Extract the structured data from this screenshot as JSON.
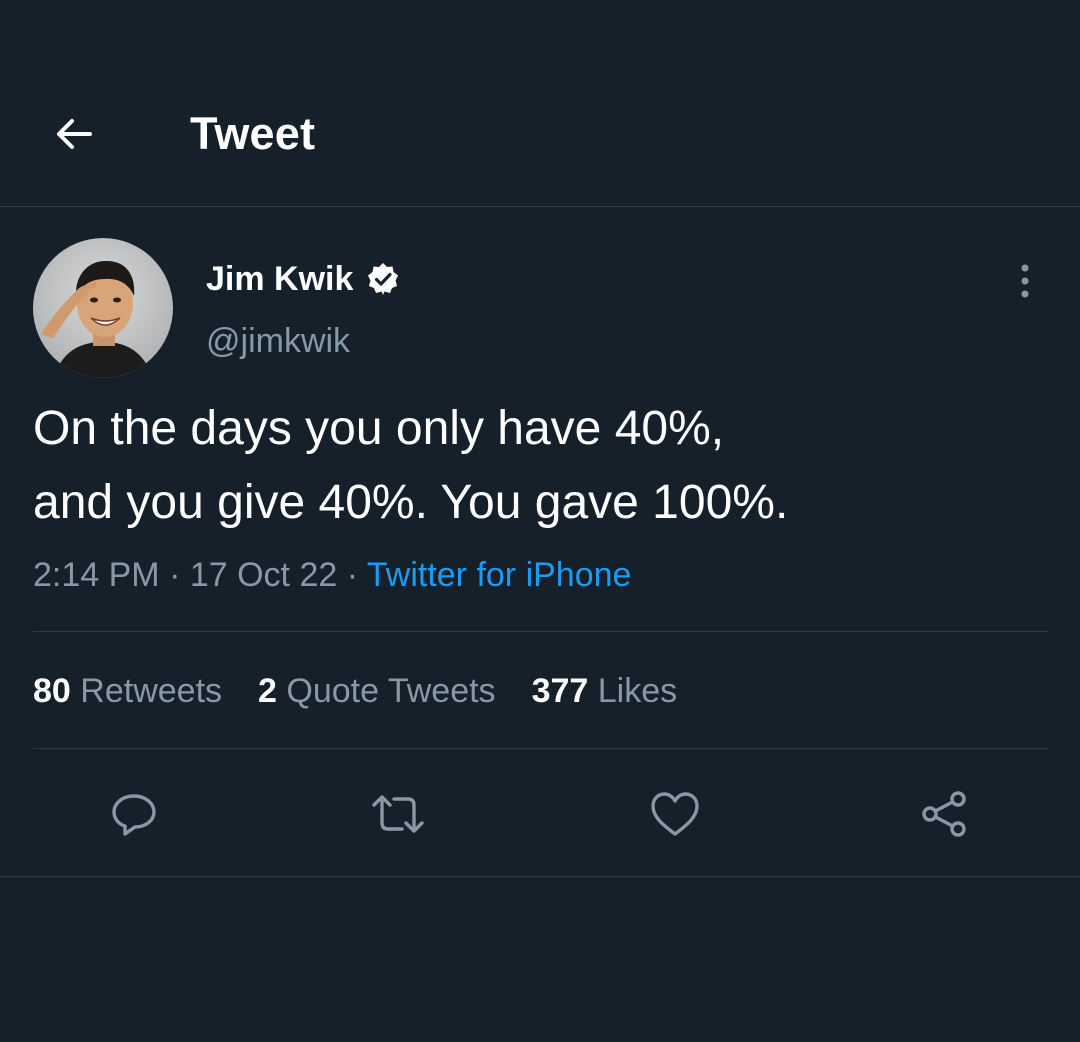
{
  "header": {
    "title": "Tweet",
    "back_icon": "arrow-left-icon"
  },
  "author": {
    "name": "Jim Kwik",
    "handle": "@jimkwik",
    "verified": true,
    "verified_icon": "verified-badge-icon",
    "more_icon": "more-vertical-icon"
  },
  "tweet": {
    "line1": "On the days you only have 40%,",
    "line2": "and you give 40%. You gave 100%.",
    "time": "2:14 PM",
    "date": "17 Oct 22",
    "separator": " · ",
    "source": "Twitter for iPhone"
  },
  "stats": {
    "retweets_count": "80",
    "retweets_label": "Retweets",
    "quotes_count": "2",
    "quotes_label": "Quote Tweets",
    "likes_count": "377",
    "likes_label": "Likes"
  },
  "actions": [
    {
      "icon": "reply-icon"
    },
    {
      "icon": "retweet-icon"
    },
    {
      "icon": "like-icon"
    },
    {
      "icon": "share-icon"
    }
  ],
  "colors": {
    "background": "#15202b",
    "text_primary": "#ffffff",
    "text_secondary": "#8899a6",
    "accent": "#1d9bf0",
    "divider": "#2f3b47"
  }
}
